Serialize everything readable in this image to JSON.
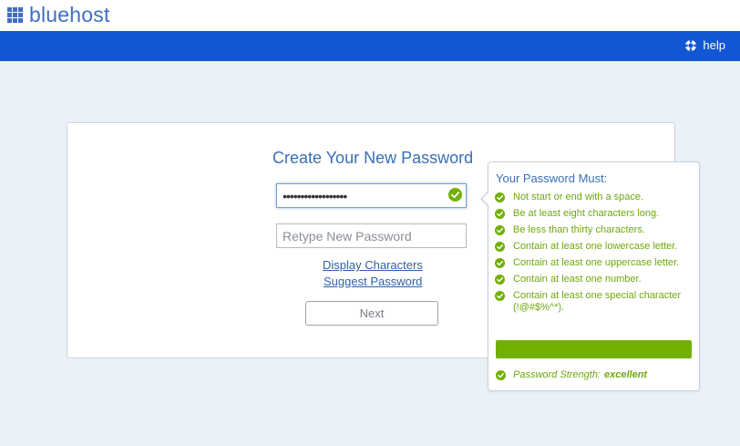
{
  "brand": {
    "name": "bluehost",
    "color": "#3f6ec4"
  },
  "nav": {
    "help_label": "help",
    "help_icon": "lifebuoy-icon",
    "bar_color": "#1356d3"
  },
  "form": {
    "title": "Create Your New Password",
    "password_value": "••••••••••••••••••",
    "retype_placeholder": "Retype New Password",
    "display_characters_label": "Display Characters",
    "suggest_password_label": "Suggest Password",
    "next_label": "Next"
  },
  "requirements": {
    "title": "Your Password Must:",
    "rules": [
      "Not start or end with a space.",
      "Be at least eight characters long.",
      "Be less than thirty characters.",
      "Contain at least one lowercase letter.",
      "Contain at least one uppercase letter.",
      "Contain at least one number.",
      "Contain at least one special character (!@#$%^*)."
    ],
    "strength_label": "Password Strength:",
    "strength_value": "excellent",
    "strength_level": 1.0,
    "success_color": "#72b000"
  }
}
